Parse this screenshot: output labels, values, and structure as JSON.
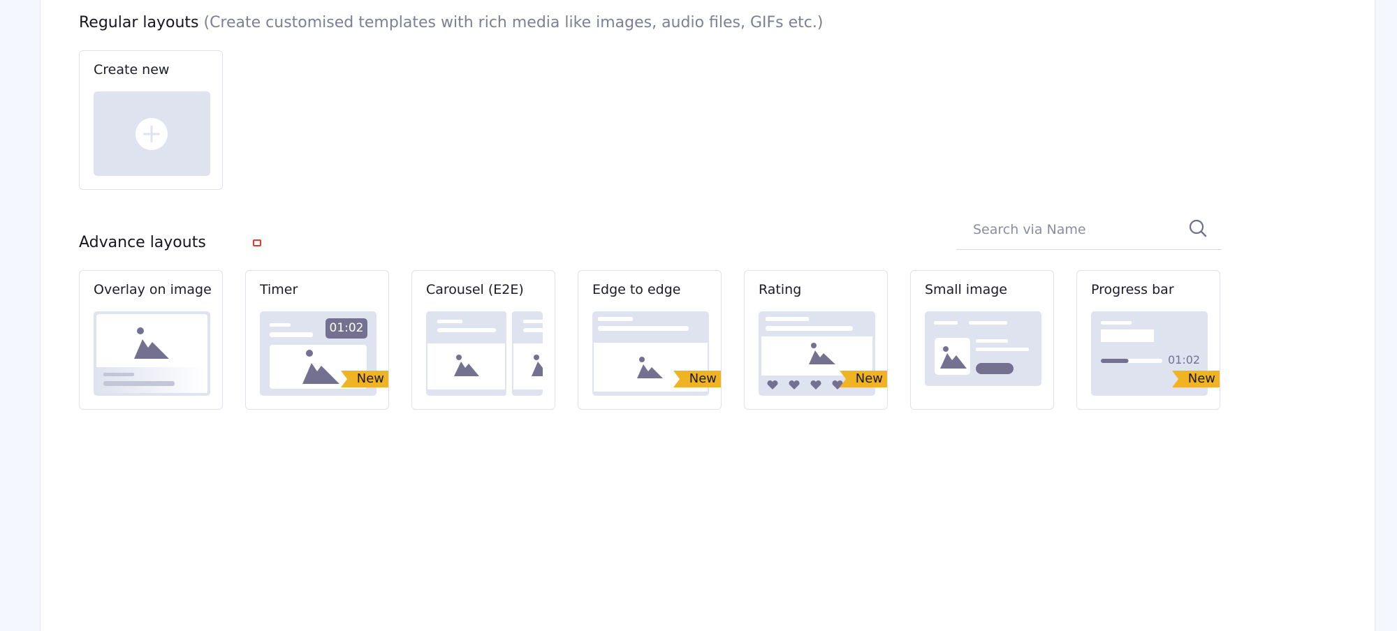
{
  "regular": {
    "title": "Regular layouts",
    "subtitle": "(Create customised templates with rich media like images, audio files, GIFs etc.)",
    "create_new": "Create new"
  },
  "advance": {
    "title": "Advance layouts",
    "search_placeholder": "Search via Name",
    "cards": [
      {
        "label": "Overlay on image",
        "is_new": false
      },
      {
        "label": "Timer",
        "is_new": true,
        "timer": "01:02"
      },
      {
        "label": "Carousel (E2E)",
        "is_new": false
      },
      {
        "label": "Edge to edge",
        "is_new": true
      },
      {
        "label": "Rating",
        "is_new": true
      },
      {
        "label": "Small image",
        "is_new": false
      },
      {
        "label": "Progress bar",
        "is_new": true,
        "timer": "01:02",
        "progress": 0.45
      }
    ],
    "badge": "New"
  },
  "icons": [
    "plus-icon",
    "search-icon",
    "image-icon",
    "heart-icon",
    "info-icon"
  ],
  "colors": {
    "accent_badge": "#f0b323",
    "thumb_bg": "#dfe3ef",
    "image_glyph": "#74708f",
    "info_icon": "#e0392f"
  }
}
